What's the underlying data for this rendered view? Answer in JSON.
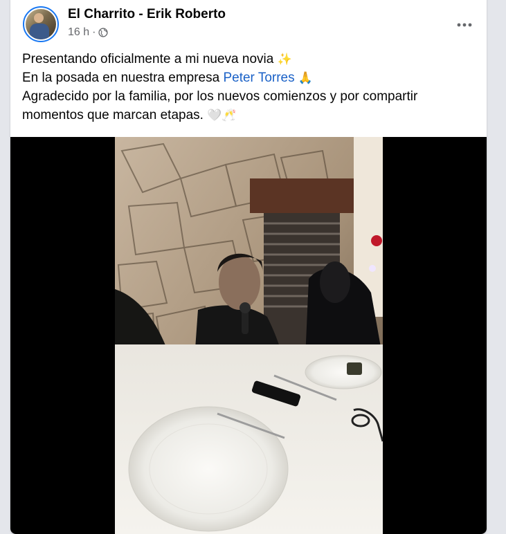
{
  "post": {
    "author": "El Charrito - Erik Roberto",
    "timestamp": "16 h",
    "separator": "·",
    "audience_icon": "globe-icon",
    "more_icon": "more-options-icon",
    "text": {
      "line1": "Presentando oficialmente a mi nueva novia",
      "line1_emoji": "✨",
      "line2_prefix": "En la posada en nuestra empresa",
      "mention": "Peter Torres",
      "line2_emoji": "🙏",
      "line3": "Agradecido por la familia, por los nuevos comienzos y por compartir",
      "line4": "momentos que marcan etapas.",
      "line4_emoji": "🤍🥂"
    }
  },
  "colors": {
    "page_bg": "#e4e6eb",
    "card_bg": "#ffffff",
    "text_primary": "#050505",
    "text_secondary": "#65676b",
    "mention": "#1a61c7",
    "avatar_ring": "#1877f2",
    "video_letterbox": "#000000"
  }
}
